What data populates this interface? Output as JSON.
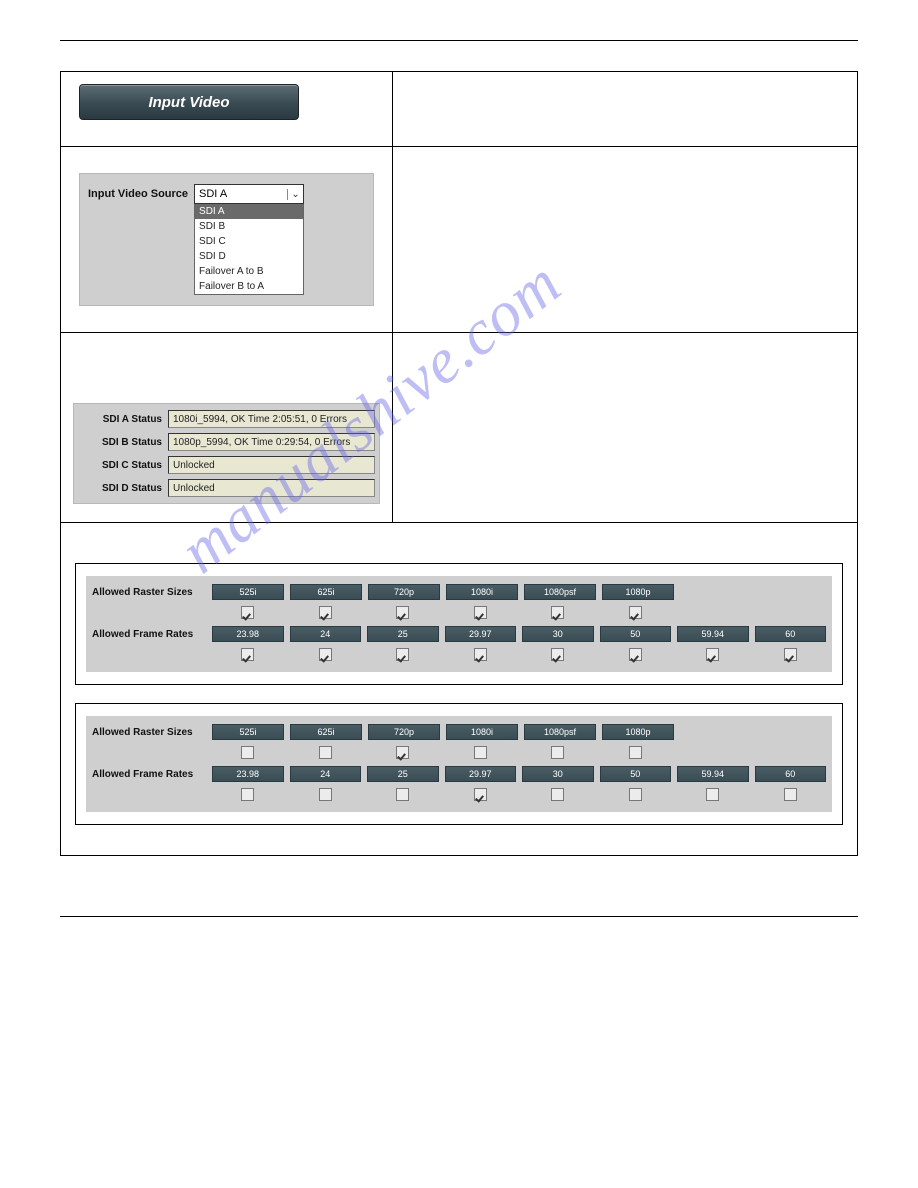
{
  "tab_title": "Input Video",
  "input_video_source": {
    "label": "Input Video Source",
    "selected": "SDI A",
    "options": [
      "SDI A",
      "SDI B",
      "SDI C",
      "SDI D",
      "Failover A to B",
      "Failover B to A"
    ]
  },
  "status": [
    {
      "label": "SDI A Status",
      "value": "1080i_5994, OK Time 2:05:51, 0 Errors"
    },
    {
      "label": "SDI B Status",
      "value": "1080p_5994, OK Time 0:29:54, 0 Errors"
    },
    {
      "label": "SDI C Status",
      "value": "Unlocked"
    },
    {
      "label": "SDI D Status",
      "value": "Unlocked"
    }
  ],
  "matrix_labels": {
    "raster": "Allowed Raster Sizes",
    "frame": "Allowed Frame Rates"
  },
  "raster_sizes": [
    "525i",
    "625i",
    "720p",
    "1080i",
    "1080psf",
    "1080p"
  ],
  "frame_rates": [
    "23.98",
    "24",
    "25",
    "29.97",
    "30",
    "50",
    "59.94",
    "60"
  ],
  "matrix1": {
    "raster_checked": [
      true,
      true,
      true,
      true,
      true,
      true
    ],
    "frame_checked": [
      true,
      true,
      true,
      true,
      true,
      true,
      true,
      true
    ]
  },
  "matrix2": {
    "raster_checked": [
      false,
      false,
      true,
      false,
      false,
      false
    ],
    "frame_checked": [
      false,
      false,
      false,
      true,
      false,
      false,
      false,
      false
    ]
  },
  "watermark": "manualshive.com"
}
